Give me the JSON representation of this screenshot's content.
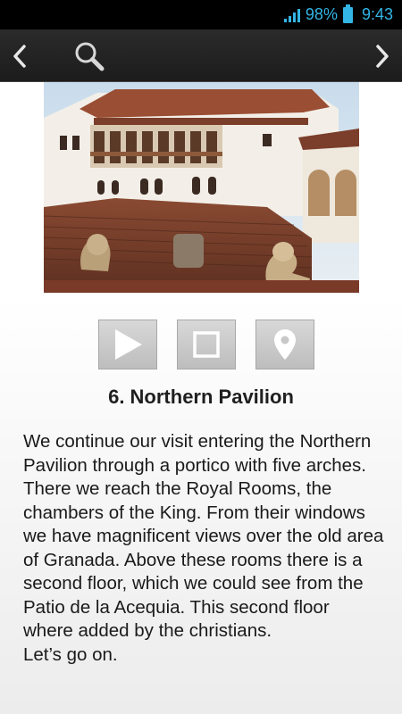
{
  "status_bar": {
    "battery_percent": "98%",
    "time": "9:43",
    "signal_icon": "signal-icon",
    "battery_icon": "battery-icon",
    "accent_color": "#33b5e5"
  },
  "action_bar": {
    "back_icon": "chevron-left-icon",
    "search_icon": "search-icon",
    "forward_icon": "chevron-right-icon"
  },
  "photo": {
    "icon": "photo-northern-pavilion"
  },
  "media_controls": {
    "play_icon": "play-icon",
    "stop_icon": "stop-icon",
    "location_icon": "map-pin-icon"
  },
  "content": {
    "title": "6. Northern Pavilion",
    "paragraph": "We continue our visit entering the Northern Pavilion through a portico with five arches. There we reach the Royal Rooms, the chambers of the King. From their windows we have magnificent views over the old area of Granada. Above these rooms there is a second floor, which we could see from the Patio de la Acequia. This second floor where added by the christians.",
    "closing": "Let’s go on."
  }
}
